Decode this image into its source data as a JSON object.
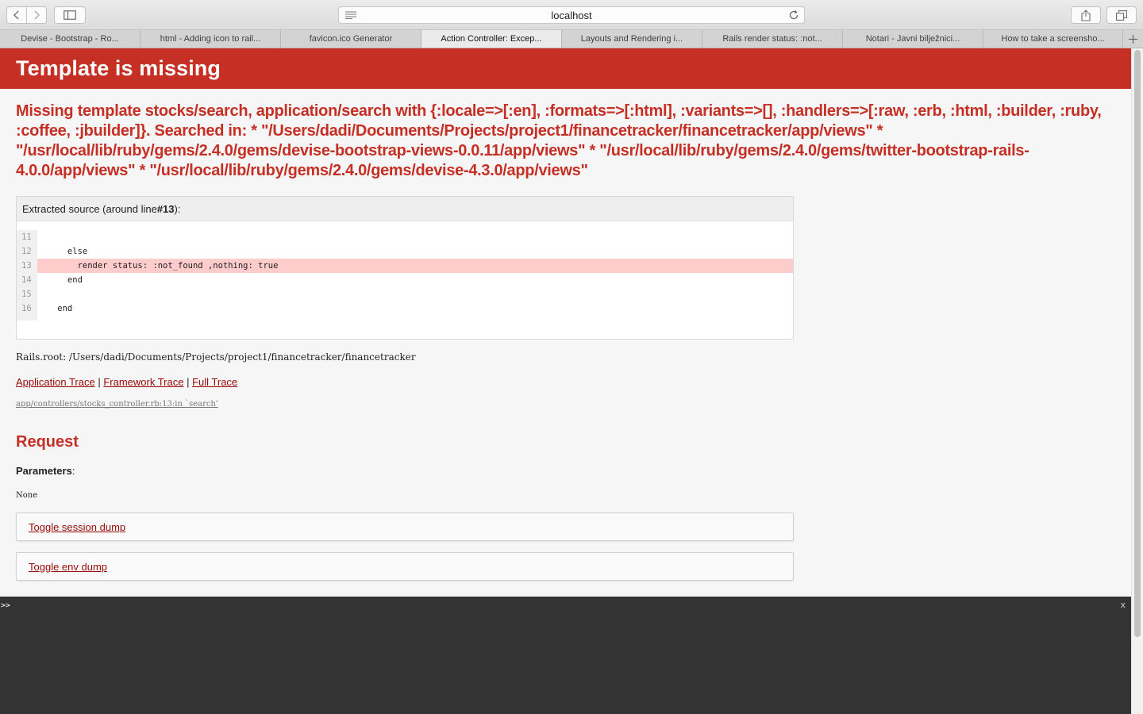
{
  "browser": {
    "address": "localhost",
    "tabs": [
      {
        "label": "Devise - Bootstrap - Ro...",
        "active": false
      },
      {
        "label": "html - Adding icon to rail...",
        "active": false
      },
      {
        "label": "favicon.ico Generator",
        "active": false
      },
      {
        "label": "Action Controller: Excep...",
        "active": true
      },
      {
        "label": "Layouts and Rendering i...",
        "active": false
      },
      {
        "label": "Rails render status: :not...",
        "active": false
      },
      {
        "label": "Notari - Javni bilježnici...",
        "active": false
      },
      {
        "label": "How to take a screensho...",
        "active": false
      }
    ],
    "new_tab_label": "+"
  },
  "page": {
    "title": "Template is missing",
    "error_message": "Missing template stocks/search, application/search with {:locale=>[:en], :formats=>[:html], :variants=>[], :handlers=>[:raw, :erb, :html, :builder, :ruby, :coffee, :jbuilder]}. Searched in: * \"/Users/dadi/Documents/Projects/project1/financetracker/financetracker/app/views\" * \"/usr/local/lib/ruby/gems/2.4.0/gems/devise-bootstrap-views-0.0.11/app/views\" * \"/usr/local/lib/ruby/gems/2.4.0/gems/twitter-bootstrap-rails-4.0.0/app/views\" * \"/usr/local/lib/ruby/gems/2.4.0/gems/devise-4.3.0/app/views\"",
    "source": {
      "heading_prefix": "Extracted source (around line ",
      "heading_line": "#13",
      "heading_suffix": "):",
      "lines": [
        {
          "num": "11",
          "code": "",
          "highlight": false
        },
        {
          "num": "12",
          "code": "      else",
          "highlight": false
        },
        {
          "num": "13",
          "code": "        render status: :not_found ,nothing: true",
          "highlight": true
        },
        {
          "num": "14",
          "code": "      end",
          "highlight": false
        },
        {
          "num": "15",
          "code": "",
          "highlight": false
        },
        {
          "num": "16",
          "code": "    end",
          "highlight": false
        }
      ]
    },
    "rails_root": "Rails.root: /Users/dadi/Documents/Projects/project1/financetracker/financetracker",
    "trace_links": {
      "application": "Application Trace",
      "framework": "Framework Trace",
      "full": "Full Trace",
      "separator": " | "
    },
    "trace_line": "app/controllers/stocks_controller.rb:13:in `search'",
    "request_heading": "Request",
    "parameters_label": "Parameters",
    "parameters_colon": ":",
    "parameters_value": "None",
    "toggle_session": "Toggle session dump",
    "toggle_env": "Toggle env dump"
  },
  "console": {
    "prompt": ">>",
    "close": "x"
  },
  "colors": {
    "header_red": "#c52f24",
    "link_red": "#980905",
    "highlight": "#ffcccc",
    "console_bg": "#333333"
  },
  "icons": [
    "chevron-left-icon",
    "chevron-right-icon",
    "sidebar-icon",
    "reader-icon",
    "reload-icon",
    "share-icon",
    "tabs-overview-icon",
    "plus-icon"
  ]
}
